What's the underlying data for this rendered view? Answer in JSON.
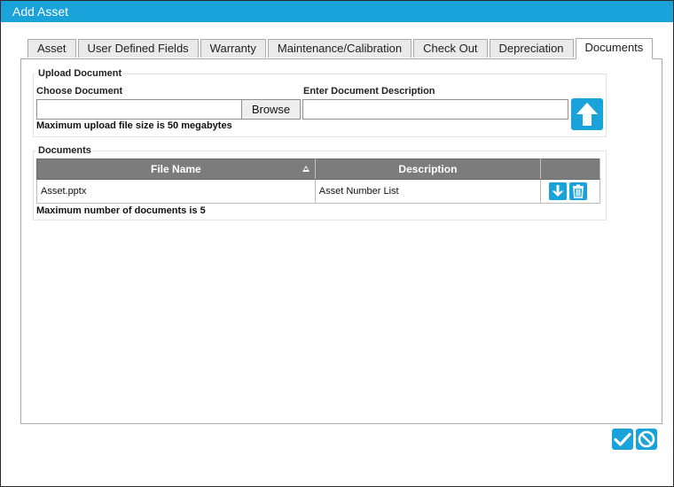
{
  "window": {
    "title": "Add Asset"
  },
  "tabs": [
    {
      "label": "Asset",
      "active": false
    },
    {
      "label": "User Defined Fields",
      "active": false
    },
    {
      "label": "Warranty",
      "active": false
    },
    {
      "label": "Maintenance/Calibration",
      "active": false
    },
    {
      "label": "Check Out",
      "active": false
    },
    {
      "label": "Depreciation",
      "active": false
    },
    {
      "label": "Documents",
      "active": true
    }
  ],
  "upload": {
    "legend": "Upload Document",
    "choose_label": "Choose Document",
    "choose_value": "",
    "browse_label": "Browse",
    "description_label": "Enter Document Description",
    "description_value": "",
    "size_note": "Maximum upload file size is 50 megabytes",
    "upload_icon": "upload-arrow-icon"
  },
  "documents": {
    "legend": "Documents",
    "columns": [
      "File Name",
      "Description",
      ""
    ],
    "rows": [
      {
        "file_name": "Asset.pptx",
        "description": "Asset Number List"
      }
    ],
    "count_note": "Maximum number of documents is 5",
    "row_icons": [
      "download-icon",
      "trash-icon"
    ]
  },
  "footer": {
    "icons": [
      "checkmark-icon",
      "cancel-icon"
    ]
  },
  "colors": {
    "accent": "#1aa3da",
    "header_bg": "#7c7c7c"
  }
}
